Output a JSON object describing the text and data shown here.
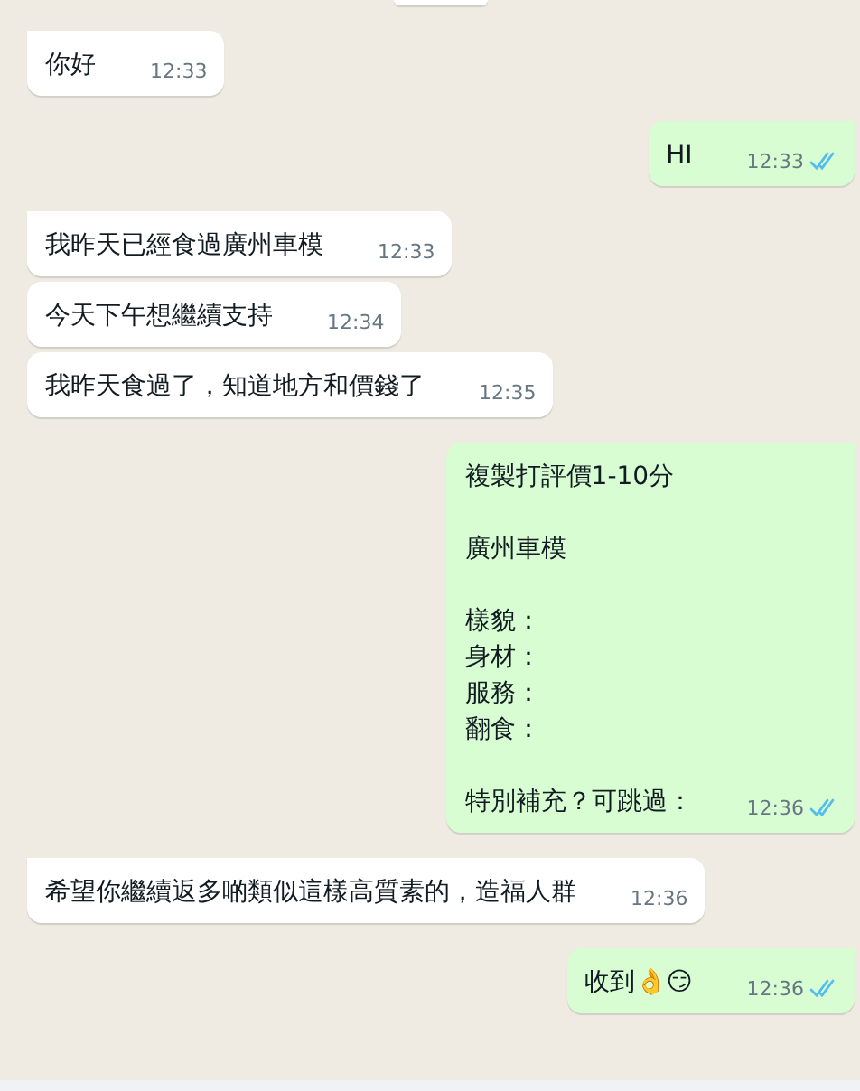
{
  "messages": [
    {
      "sent": false,
      "tail": true,
      "text": "你好",
      "time": "12:33"
    },
    {
      "sent": true,
      "tail": true,
      "text": "HI",
      "time": "12:33",
      "read": true
    },
    {
      "sent": false,
      "tail": true,
      "text": "我昨天已經食過廣州車模",
      "time": "12:33"
    },
    {
      "sent": false,
      "tail": false,
      "text": "今天下午想繼續支持",
      "time": "12:34"
    },
    {
      "sent": false,
      "tail": false,
      "text": "我昨天食過了，知道地方和價錢了",
      "time": "12:35"
    },
    {
      "sent": true,
      "tail": true,
      "paragraphs": [
        [
          "複製打評價1-10分"
        ],
        [
          "廣州車模"
        ],
        [
          "樣貌：",
          "身材：",
          "服務：",
          "翻食："
        ],
        [
          "特別補充？可跳過："
        ]
      ],
      "time": "12:36",
      "read": true
    },
    {
      "sent": false,
      "tail": true,
      "text": "希望你繼續返多啲類似這樣高質素的，造福人群",
      "time": "12:36"
    },
    {
      "sent": true,
      "tail": true,
      "text": "收到👌😏",
      "time": "12:36",
      "read": true
    }
  ]
}
